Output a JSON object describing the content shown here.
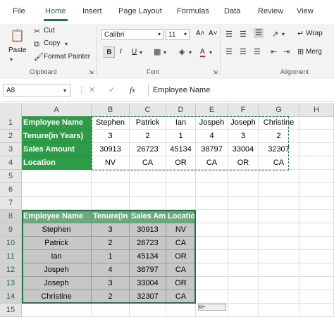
{
  "tabs": [
    "File",
    "Home",
    "Insert",
    "Page Layout",
    "Formulas",
    "Data",
    "Review",
    "View"
  ],
  "ribbon": {
    "clipboard": {
      "paste": "Paste",
      "cut": "Cut",
      "copy": "Copy",
      "format_painter": "Format Painter",
      "label": "Clipboard"
    },
    "font": {
      "name": "Calibri",
      "size": "11",
      "grow": "A˄",
      "shrink": "A˅",
      "bold": "B",
      "italic": "I",
      "underline": "U",
      "font_color": "A",
      "label": "Font"
    },
    "alignment": {
      "wrap": "Wrap",
      "merge": "Merg",
      "label": "Alignment"
    }
  },
  "formula_bar": {
    "name_box": "A8",
    "fx": "fx",
    "content": "Employee Name"
  },
  "columns": [
    "A",
    "B",
    "C",
    "D",
    "E",
    "F",
    "G",
    "H"
  ],
  "rows": [
    "1",
    "2",
    "3",
    "4",
    "5",
    "6",
    "7",
    "8",
    "9",
    "10",
    "11",
    "12",
    "13",
    "14",
    "15"
  ],
  "table1": {
    "headers": [
      "Employee Name",
      "Tenure(in Years)",
      "Sales Amount",
      "Location"
    ],
    "row1": [
      "Stephen",
      "Patrick",
      "Ian",
      "Jospeh",
      "Joseph",
      "Christine"
    ],
    "row2": [
      "3",
      "2",
      "1",
      "4",
      "3",
      "2"
    ],
    "row3": [
      "30913",
      "26723",
      "45134",
      "38797",
      "33004",
      "32307"
    ],
    "row4": [
      "NV",
      "CA",
      "OR",
      "CA",
      "OR",
      "CA"
    ]
  },
  "table2": {
    "headers": [
      "Employee Name",
      "Tenure(in",
      "Sales Am",
      "Locatio"
    ],
    "rows": [
      [
        "Stephen",
        "3",
        "30913",
        "NV"
      ],
      [
        "Patrick",
        "2",
        "26723",
        "CA"
      ],
      [
        "Ian",
        "1",
        "45134",
        "OR"
      ],
      [
        "Jospeh",
        "4",
        "38797",
        "CA"
      ],
      [
        "Joseph",
        "3",
        "33004",
        "OR"
      ],
      [
        "Christine",
        "2",
        "32307",
        "CA"
      ]
    ]
  },
  "colors": {
    "accent": "#217346",
    "header_green": "#2e9b48",
    "cell_gray": "#c7c7c7"
  }
}
